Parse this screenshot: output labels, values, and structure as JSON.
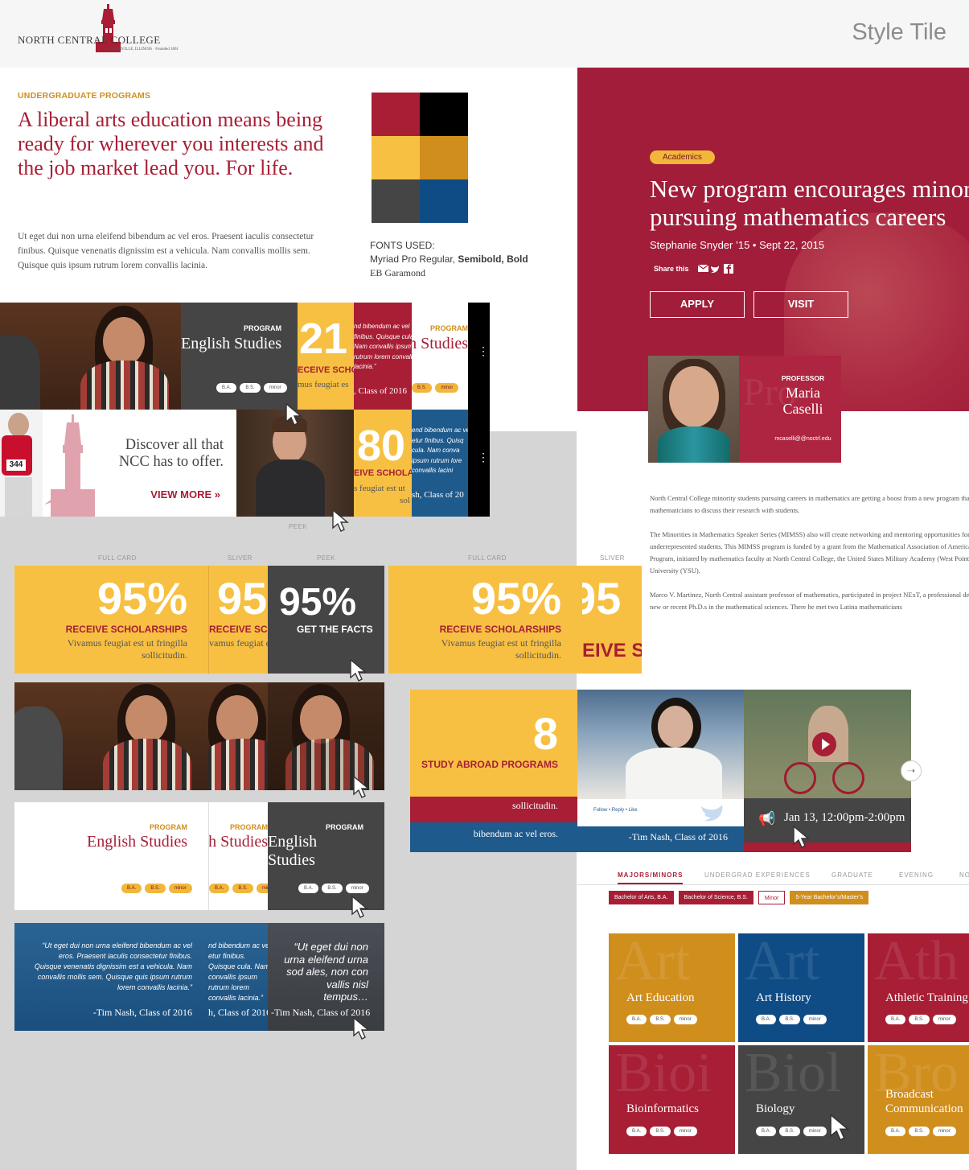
{
  "header": {
    "logo_text": "NORTH CENTRAL COLLEGE",
    "logo_sub": "NAPERVILLE, ILLINOIS · Founded 1861",
    "title": "Style Tile"
  },
  "intro": {
    "eyebrow": "UNDERGRADUATE PROGRAMS",
    "headline": "A liberal arts education means being ready for wherever you interests and the job market lead you. For life.",
    "body": "Ut eget dui non urna eleifend bibendum ac vel eros. Praesent iaculis consectetur finibus. Quisque venenatis dignissim est a vehicula. Nam convallis mollis sem. Quisque quis ipsum rutrum lorem convallis lacinia."
  },
  "palette": [
    "#a71e35",
    "#000000",
    "#f7c043",
    "#d08e1d",
    "#454545",
    "#0f4c86"
  ],
  "fonts_used": {
    "label": "FONTS USED:",
    "line1": "Myriad Pro Regular,",
    "line1_bold": "Semibold, Bold",
    "line2": "EB Garamond"
  },
  "article": {
    "tag": "Academics",
    "title_line1": "New program encourages minority",
    "title_line2": "pursuing mathematics careers",
    "byline": "Stephanie Snyder ’15 • Sept 22, 2015",
    "share_label": "Share this",
    "share_icons": [
      "mail-icon",
      "twitter-icon",
      "facebook-icon"
    ],
    "apply": "APPLY",
    "visit": "VISIT",
    "p1_line1": "North Central College minority students pursuing careers in mathematics are getting a boost from a new program that brings",
    "p1_line2": "mathematicians to discuss their research with students.",
    "p2_line1": "The Minorities in Mathematics Speaker Series (MIMSS) also will create networking and mentoring opportunities for",
    "p2_line2": "underrepresented students. This MIMSS program is funded by a grant from the Mathematical Association of America",
    "p2_line3": "Program, initiated by mathematics faculty at North Central College, the United States Military Academy (West Point) and",
    "p2_line4": "University (YSU).",
    "p3_line1": "Marco V. Martinez, North Central assistant professor of mathematics, participated in project NExT, a professional development",
    "p3_line2": "new or recent Ph.D.s in the mathematical sciences. There he met two Latina mathematicians"
  },
  "professor": {
    "label": "PROFESSOR",
    "first": "Maria",
    "last": "Caselli",
    "email": "mcaselli@@noctrl.edu",
    "watermark": "Pro"
  },
  "row1": {
    "program_label": "PROGRAM",
    "program_name": "English Studies",
    "program_partial": "h Studies",
    "degrees": [
      "B.A.",
      "B.S.",
      "minor"
    ],
    "stat1": "21",
    "stat1_label_partial": "ECEIVE SCHO",
    "stat1_text_partial": "mus feugiat es",
    "quote_partial": "nd bibendum ac vel finibus. Quisque cula. Nam convallis ipsum rutrum lorem convallis lacinia.”",
    "quote_attr_partial": ", Class of 2016",
    "discover_text": "Discover all that NCC has to offer.",
    "view_more": "VIEW MORE",
    "stat2": "80",
    "stat2_label_partial": "EIVE SCHOLA",
    "stat2_text_partial": "s feugiat est ut",
    "stat2_text2": "sol",
    "quote2_partial": "end bibendum ac vel etur finibus. Quisq cula. Nam conva ipsum rutrum lore convallis lacini",
    "quote2_attr_partial": "sh, Class of 20",
    "runner_number": "344",
    "peek_label": "PEEK"
  },
  "labels": {
    "full_card": "FULL CARD",
    "sliver": "SLIVER",
    "peek": "PEEK"
  },
  "stat_cards": {
    "number": "95%",
    "number_partial": "95",
    "label": "RECEIVE SCHOLARSHIPS",
    "label_partial": "RECEIVE SCHO",
    "label_partial2": "EIVE SC",
    "text_line1": "Vivamus feugiat est ut fringilla",
    "text_line2": "sollicitudin.",
    "text_partial": "vamus feugiat e",
    "facts": "GET THE FACTS"
  },
  "quote_cards": {
    "quote": "“Ut eget dui non urna eleifend bibendum ac vel eros. Praesent iaculis consectetur finibus. Quisque venenatis dignissim est a vehicula. Nam convallis mollis sem. Quisque quis ipsum rutrum lorem convallis lacinia.”",
    "quote_partial": "nd bibendum ac vel etur finibus. Quisque cula. Nam convallis ipsum rutrum lorem convallis lacinia.”",
    "attribution": "-Tim Nash, Class of 2016",
    "attribution_partial": "h, Class of 2016",
    "quote_peek": "“Ut eget dui non urna eleifend urna sod ales, non con vallis nisl tempus…"
  },
  "carousel": {
    "stat": "8",
    "stat_label": "STUDY ABROAD PROGRAMS",
    "sub_text": "sollicitudin.",
    "sub_text2": "bibendum ac vel eros.",
    "tweet_links": "Follow • Reply • Like",
    "tweet_attr": "-Tim Nash, Class of 2016",
    "event": "Jan 13, 12:00pm-2:00pm"
  },
  "majors": {
    "tabs": [
      "MAJORS/MINORS",
      "UNDERGRAD EXPERIENCES",
      "GRADUATE",
      "EVENING",
      "NO"
    ],
    "chips": [
      "Bachelor of Arts, B.A.",
      "Bachelor of Science, B.S.",
      "Minor",
      "5-Year Bachelor’s/Master’s"
    ],
    "tiles": [
      {
        "name": "Art Education",
        "bg": "Art",
        "color": "#d08e1d"
      },
      {
        "name": "Art History",
        "bg": "Art",
        "color": "#0f4c86"
      },
      {
        "name": "Athletic Training",
        "bg": "Ath",
        "color": "#a71e35"
      },
      {
        "name": "Bioinformatics",
        "bg": "Bioi",
        "color": "#a71e35"
      },
      {
        "name": "Biology",
        "bg": "Biol",
        "color": "#454545"
      },
      {
        "name": "Broadcast Communication",
        "bg": "Bro",
        "color": "#d08e1d"
      }
    ],
    "degrees": [
      "B.A.",
      "B.S.",
      "minor"
    ]
  }
}
